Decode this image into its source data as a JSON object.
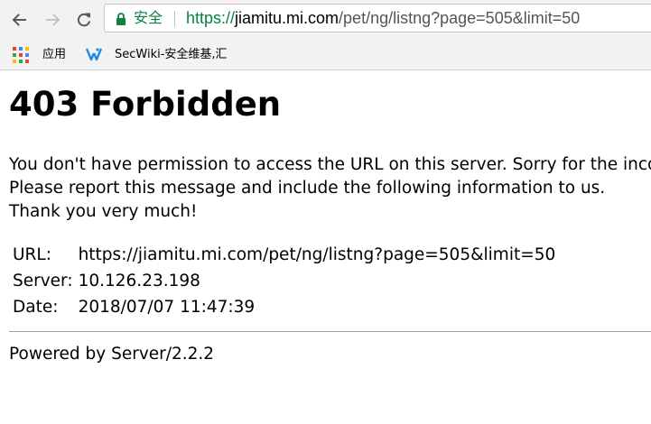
{
  "browser": {
    "secure_label": "安全",
    "url": {
      "scheme": "https://",
      "host": "jiamitu.mi.com",
      "path": "/pet/ng/listng?page=505&limit=50"
    },
    "icons": {
      "back": "back-arrow-icon",
      "forward": "forward-arrow-icon",
      "reload": "reload-icon",
      "lock": "lock-icon"
    },
    "colors": {
      "secure": "#0b8043",
      "chrome_bg": "#f2f2f2"
    }
  },
  "bookmarks": {
    "apps_label": "应用",
    "secwiki_label": "SecWiki-安全维基,汇"
  },
  "page": {
    "heading": "403 Forbidden",
    "message_lines": [
      "You don't have permission to access the URL on this server. Sorry for the inconvenience.",
      "Please report this message and include the following information to us.",
      "Thank you very much!"
    ],
    "info": {
      "url_key": "URL:",
      "url_value": "https://jiamitu.mi.com/pet/ng/listng?page=505&limit=50",
      "server_key": "Server:",
      "server_value": "10.126.23.198",
      "date_key": "Date:",
      "date_value": "2018/07/07 11:47:39"
    },
    "footer": "Powered by Server/2.2.2"
  }
}
